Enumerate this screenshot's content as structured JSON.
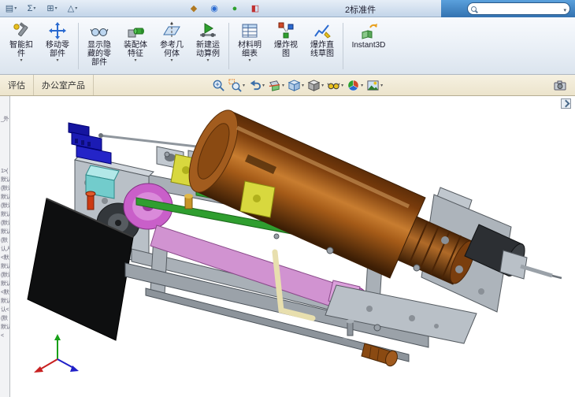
{
  "title_bar": {
    "title": "2标准件",
    "left_icons": [
      {
        "name": "document-icon",
        "glyph": "▤"
      },
      {
        "name": "sigma-icon",
        "glyph": "Σ"
      },
      {
        "name": "window-icon",
        "glyph": "⊞"
      },
      {
        "name": "warning-icon",
        "glyph": "△"
      }
    ],
    "mid_icons": [
      {
        "name": "wrench-icon",
        "glyph": "◆"
      },
      {
        "name": "target-icon",
        "glyph": "◉"
      },
      {
        "name": "globe-icon",
        "glyph": "●"
      },
      {
        "name": "palette-icon",
        "glyph": "◧"
      }
    ],
    "search": {
      "value": ""
    }
  },
  "ribbon": {
    "buttons": [
      {
        "label": "智能扣件",
        "icon": "smart-fastener-icon",
        "dropdown": true
      },
      {
        "label": "移动零部件",
        "icon": "move-component-icon",
        "dropdown": true
      },
      {
        "label": "显示隐藏的零部件",
        "icon": "show-hidden-components-icon",
        "dropdown": false
      },
      {
        "label": "装配体特征",
        "icon": "assembly-features-icon",
        "dropdown": true
      },
      {
        "label": "参考几何体",
        "icon": "reference-geometry-icon",
        "dropdown": true
      },
      {
        "label": "新建运动算例",
        "icon": "new-motion-study-icon",
        "dropdown": true
      },
      {
        "label": "材料明细表",
        "icon": "bill-of-materials-icon",
        "dropdown": true
      },
      {
        "label": "爆炸视图",
        "icon": "exploded-view-icon",
        "dropdown": false
      },
      {
        "label": "爆炸直线草图",
        "icon": "explode-line-sketch-icon",
        "dropdown": false
      },
      {
        "label": "Instant3D",
        "icon": "instant3d-icon",
        "dropdown": false
      }
    ]
  },
  "tabs": {
    "items": [
      {
        "label": "评估"
      },
      {
        "label": "办公室产品"
      }
    ]
  },
  "view_toolbar": {
    "icons": [
      {
        "name": "zoom-fit-icon",
        "dropdown": false
      },
      {
        "name": "zoom-area-icon",
        "dropdown": true
      },
      {
        "name": "previous-view-icon",
        "dropdown": true
      },
      {
        "name": "section-view-icon",
        "dropdown": true
      },
      {
        "name": "view-orientation-icon",
        "dropdown": true
      },
      {
        "name": "display-style-icon",
        "dropdown": true
      },
      {
        "name": "hide-show-items-icon",
        "dropdown": true
      },
      {
        "name": "edit-appearance-icon",
        "dropdown": true
      },
      {
        "name": "view-settings-icon",
        "dropdown": true
      }
    ]
  },
  "feature_tree": {
    "items": [
      "",
      "",
      "_外",
      "",
      "",
      "",
      "",
      "",
      "1>(",
      "默认<",
      "(默认",
      "默认人",
      "(默认",
      "默认人",
      "(默认",
      "默认人",
      "(默",
      "认人",
      "<默",
      "默认",
      "(默认",
      "默认人",
      "<默认",
      "默认",
      "认<",
      "(默",
      "默认人",
      "<"
    ]
  },
  "model": {
    "colors": {
      "chassis": "#b9c0c7",
      "motor": "#8a4a12",
      "belt": "#d193d1",
      "pulley": "#c95fc9",
      "rail": "#2f9e2f",
      "bracket": "#1b1bb4",
      "slider": "#72cccc",
      "tensioner": "#d8d83e",
      "base": "#0e0f10",
      "knob": "#8a4a12",
      "wheel": "#33373b"
    },
    "parts": [
      {
        "name": "motor-cylinder",
        "color": "#8a4a12"
      },
      {
        "name": "chassis-frame",
        "color": "#b9c0c7"
      },
      {
        "name": "drive-belt",
        "color": "#d193d1"
      },
      {
        "name": "pulley",
        "color": "#c95fc9"
      },
      {
        "name": "linear-rail",
        "color": "#2f9e2f"
      },
      {
        "name": "blue-bracket",
        "color": "#1b1bb4"
      },
      {
        "name": "cyan-slider",
        "color": "#72cccc"
      },
      {
        "name": "yellow-tensioner",
        "color": "#d8d83e"
      },
      {
        "name": "black-base-plate",
        "color": "#0e0f10"
      },
      {
        "name": "brown-knob",
        "color": "#8a4a12"
      },
      {
        "name": "dark-wheel",
        "color": "#33373b"
      },
      {
        "name": "red-screw",
        "color": "#cc3a12"
      }
    ],
    "triad": {
      "x_color": "#c82020",
      "y_color": "#18a018",
      "z_color": "#2020c8"
    }
  }
}
